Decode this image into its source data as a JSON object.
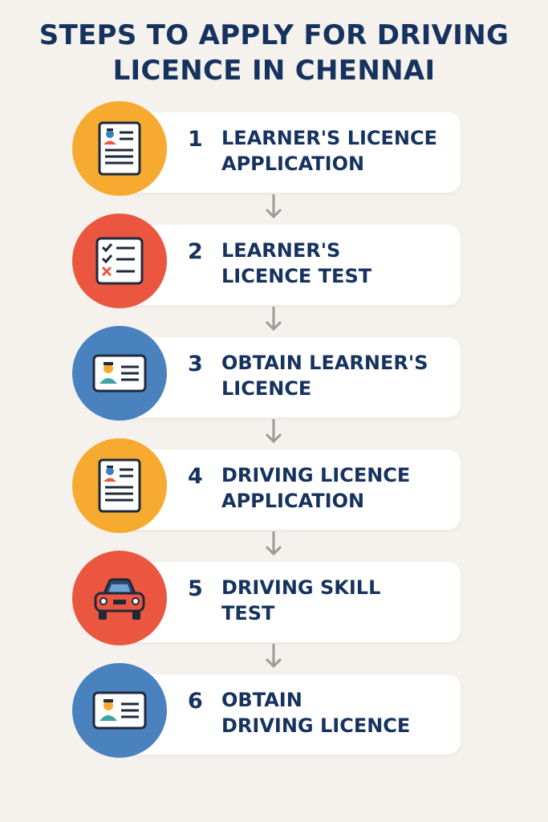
{
  "title": {
    "line1": "STEPS TO APPLY FOR DRIVING",
    "line2": "LICENCE IN CHENNAI"
  },
  "colors": {
    "title": "#16325e",
    "yellow": "#f6ab30",
    "red": "#ea5640",
    "blue": "#4a82c0",
    "arrow": "#9a9a9a"
  },
  "steps": [
    {
      "number": "1",
      "label": "LEARNER'S LICENCE\nAPPLICATION",
      "icon": "application-form-icon",
      "color": "#f6ab30"
    },
    {
      "number": "2",
      "label": "LEARNER'S\nLICENCE  TEST",
      "icon": "test-checklist-icon",
      "color": "#ea5640"
    },
    {
      "number": "3",
      "label": "OBTAIN LEARNER'S\nLICENCE",
      "icon": "id-card-icon",
      "color": "#4a82c0"
    },
    {
      "number": "4",
      "label": "DRIVING LICENCE\nAPPLICATION",
      "icon": "application-form-icon",
      "color": "#f6ab30"
    },
    {
      "number": "5",
      "label": "DRIVING SKILL\nTEST",
      "icon": "car-icon",
      "color": "#ea5640"
    },
    {
      "number": "6",
      "label": "OBTAIN\nDRIVING LICENCE",
      "icon": "id-card-icon",
      "color": "#4a82c0"
    }
  ]
}
